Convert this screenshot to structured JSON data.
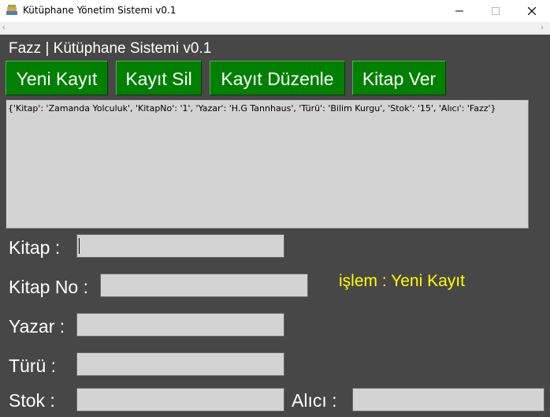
{
  "window": {
    "title": "Kütüphane Yönetim Sistemi v0.1",
    "controls": [
      "minimize",
      "maximize",
      "close"
    ]
  },
  "header": {
    "title": "Fazz | Kütüphane Sistemi v0.1"
  },
  "toolbar": {
    "buttons": [
      {
        "label": "Yeni Kayıt"
      },
      {
        "label": "Kayıt Sil"
      },
      {
        "label": "Kayıt Düzenle"
      },
      {
        "label": "Kitap Ver"
      }
    ]
  },
  "records": [
    "{'Kitap': 'Zamanda Yolculuk', 'KitapNo': '1', 'Yazar': 'H.G Tannhaus', 'Türü': 'Bilim Kurgu', 'Stok': '15', 'Alıcı': 'Fazz'}"
  ],
  "form": {
    "kitap": {
      "label": "Kitap :",
      "value": ""
    },
    "kitap_no": {
      "label": "Kitap No :",
      "value": ""
    },
    "yazar": {
      "label": "Yazar :",
      "value": ""
    },
    "turu": {
      "label": "Türü :",
      "value": ""
    },
    "stok": {
      "label": "Stok :",
      "value": ""
    },
    "alici": {
      "label": "Alıcı :",
      "value": ""
    }
  },
  "status": {
    "text": "işlem : Yeni Kayıt"
  },
  "colors": {
    "background": "#474747",
    "button": "#008000",
    "field": "#d3d3d3",
    "status_text": "#ffff00"
  }
}
